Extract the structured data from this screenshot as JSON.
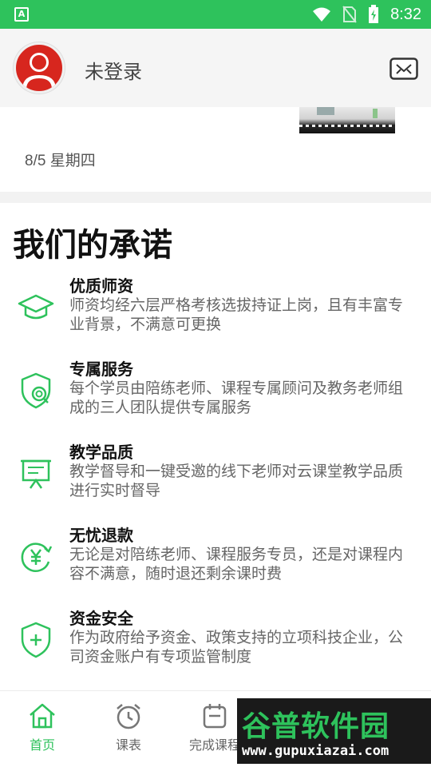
{
  "status_bar": {
    "time": "8:32",
    "app_badge": "A"
  },
  "header": {
    "login_status": "未登录"
  },
  "recent": {
    "date": "8/5 星期四"
  },
  "promise": {
    "title": "我们的承诺",
    "items": [
      {
        "icon": "graduation-cap-icon",
        "title": "优质师资",
        "desc": "师资均经六层严格考核选拔持证上岗，且有丰富专业背景，不满意可更换"
      },
      {
        "icon": "shield-search-icon",
        "title": "专属服务",
        "desc": "每个学员由陪练老师、课程专属顾问及教务老师组成的三人团队提供专属服务"
      },
      {
        "icon": "presentation-board-icon",
        "title": "教学品质",
        "desc": "教学督导和一键受邀的线下老师对云课堂教学品质进行实时督导"
      },
      {
        "icon": "yuan-refresh-icon",
        "title": "无忧退款",
        "desc": "无论是对陪练老师、课程服务专员，还是对课程内容不满意，随时退还剩余课时费"
      },
      {
        "icon": "shield-plus-icon",
        "title": "资金安全",
        "desc": "作为政府给予资金、政策支持的立项科技企业，公司资金账户有专项监管制度"
      }
    ]
  },
  "tabs": [
    {
      "label": "首页",
      "icon": "home-icon",
      "active": true
    },
    {
      "label": "课表",
      "icon": "alarm-clock-icon",
      "active": false
    },
    {
      "label": "完成课程",
      "icon": "calendar-check-icon",
      "active": false
    }
  ],
  "watermark": {
    "brand": "谷普软件园",
    "url": "www.gupuxiazai.com"
  },
  "colors": {
    "accent": "#2ec25c",
    "avatar_red": "#d7261e"
  }
}
